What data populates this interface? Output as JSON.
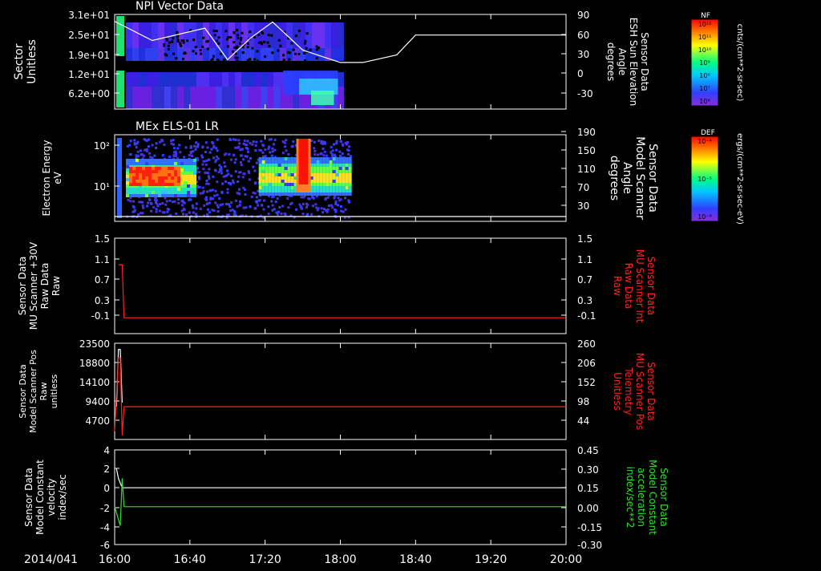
{
  "date_label": "2014/041",
  "time_ticks": [
    "16:00",
    "16:40",
    "17:20",
    "18:00",
    "18:40",
    "19:20",
    "20:00"
  ],
  "chart_data": [
    {
      "type": "heatmap",
      "title": "NPI Vector Data",
      "ylabel": "Sector Unitless",
      "ylabel_lines": [
        "Sector",
        "Unitless"
      ],
      "yticks": [
        "3.1e+01",
        "2.5e+01",
        "1.9e+01",
        "1.2e+01",
        "6.2e+00"
      ],
      "y2label_lines": [
        "Sensor Data",
        "ESH Sun Elevation",
        "Angle",
        "degrees"
      ],
      "y2ticks": [
        "90",
        "60",
        "30",
        "0",
        "-30"
      ],
      "colorbar": {
        "label": "NF",
        "unit": "cnts/(cm**2-sr-sec)",
        "ticks": [
          "10¹²",
          "10¹¹",
          "10¹⁰",
          "10⁹",
          "10⁸",
          "10⁷",
          "10⁶"
        ]
      },
      "line_series": {
        "name": "ESH Sun Elevation Angle",
        "x": [
          "16:00",
          "16:20",
          "16:48",
          "17:00",
          "17:12",
          "17:24",
          "17:40",
          "18:00",
          "18:12",
          "18:30",
          "18:40",
          "20:00"
        ],
        "y": [
          80,
          52,
          70,
          24,
          55,
          79,
          38,
          20,
          20,
          31,
          60,
          60
        ]
      }
    },
    {
      "type": "heatmap",
      "title": "MEx ELS-01 LR",
      "ylabel_lines": [
        "Electron Energy",
        "eV"
      ],
      "yticks": [
        "10²",
        "10¹"
      ],
      "y2label_lines": [
        "Sensor Data",
        "Model Scanner",
        "Angle",
        "degrees"
      ],
      "y2ticks": [
        "190",
        "150",
        "110",
        "70",
        "30"
      ],
      "colorbar": {
        "label": "DEF",
        "unit": "ergs/(cm**2-sr-sec-eV)",
        "ticks": [
          "10⁻⁴",
          "10⁻⁵",
          "10⁻⁶"
        ]
      },
      "data_extent_x": [
        "16:00",
        "18:05"
      ],
      "line_series": {
        "name": "Model Scanner Angle",
        "x": [
          "16:00",
          "20:00"
        ],
        "y": [
          20,
          20
        ]
      }
    },
    {
      "type": "line",
      "ylabel_lines": [
        "Sensor Data",
        "MU Scanner +30V",
        "Raw Data",
        "Raw"
      ],
      "yticks": [
        "1.5",
        "1.1",
        "0.7",
        "0.3",
        "-0.1"
      ],
      "ylim": [
        -0.3,
        1.5
      ],
      "y2label_lines": [
        "Sensor Data",
        "MU Scanner Int",
        "Raw Data",
        "Raw"
      ],
      "y2ticks": [
        "1.5",
        "1.1",
        "0.7",
        "0.3",
        "-0.1"
      ],
      "series": [
        {
          "color": "#ff2020",
          "x": [
            "16:02",
            "16:04",
            "16:05",
            "16:06",
            "20:00"
          ],
          "y": [
            1.0,
            1.0,
            0.0,
            0.0,
            0.0
          ]
        }
      ]
    },
    {
      "type": "line",
      "ylabel_lines": [
        "Sensor Data",
        "Model Scanner Pos",
        "Raw",
        "unitless"
      ],
      "yticks": [
        "23500",
        "18800",
        "14100",
        "9400",
        "4700"
      ],
      "ylim": [
        0,
        23500
      ],
      "y2label_lines": [
        "Sensor Data",
        "MU Scanner Pos",
        "Telemetry",
        "Unitless"
      ],
      "y2ticks": [
        "260",
        "206",
        "152",
        "98",
        "44"
      ],
      "series": [
        {
          "color": "#ffffff",
          "x": [
            "16:01",
            "16:02",
            "16:03",
            "16:04"
          ],
          "y": [
            8000,
            22000,
            22000,
            9000
          ]
        },
        {
          "color": "#ff2020",
          "x": [
            "16:00",
            "16:02",
            "16:03",
            "16:04",
            "16:05",
            "20:00"
          ],
          "y": [
            2000,
            20000,
            20000,
            1000,
            8000,
            8000
          ]
        }
      ]
    },
    {
      "type": "line",
      "ylabel_lines": [
        "Sensor Data",
        "Model Constant",
        "velocity",
        "index/sec"
      ],
      "yticks": [
        "4",
        "2",
        "0",
        "-2",
        "-4",
        "-6"
      ],
      "ylim": [
        -6,
        4
      ],
      "y2label_lines": [
        "Sensor Data",
        "Model Constant",
        "acceleration",
        "index/sec**2"
      ],
      "y2ticks": [
        "0.45",
        "0.30",
        "0.15",
        "0.00",
        "-0.15",
        "-0.30"
      ],
      "series": [
        {
          "color": "#ffffff",
          "x": [
            "16:01",
            "16:02",
            "16:03",
            "16:04",
            "20:00"
          ],
          "y": [
            2,
            1,
            0.5,
            0,
            0
          ]
        },
        {
          "color": "#30e030",
          "x": [
            "16:00",
            "16:03",
            "16:04",
            "16:05",
            "20:00"
          ],
          "y": [
            -2,
            -4,
            1,
            -2,
            -2
          ]
        }
      ]
    }
  ]
}
